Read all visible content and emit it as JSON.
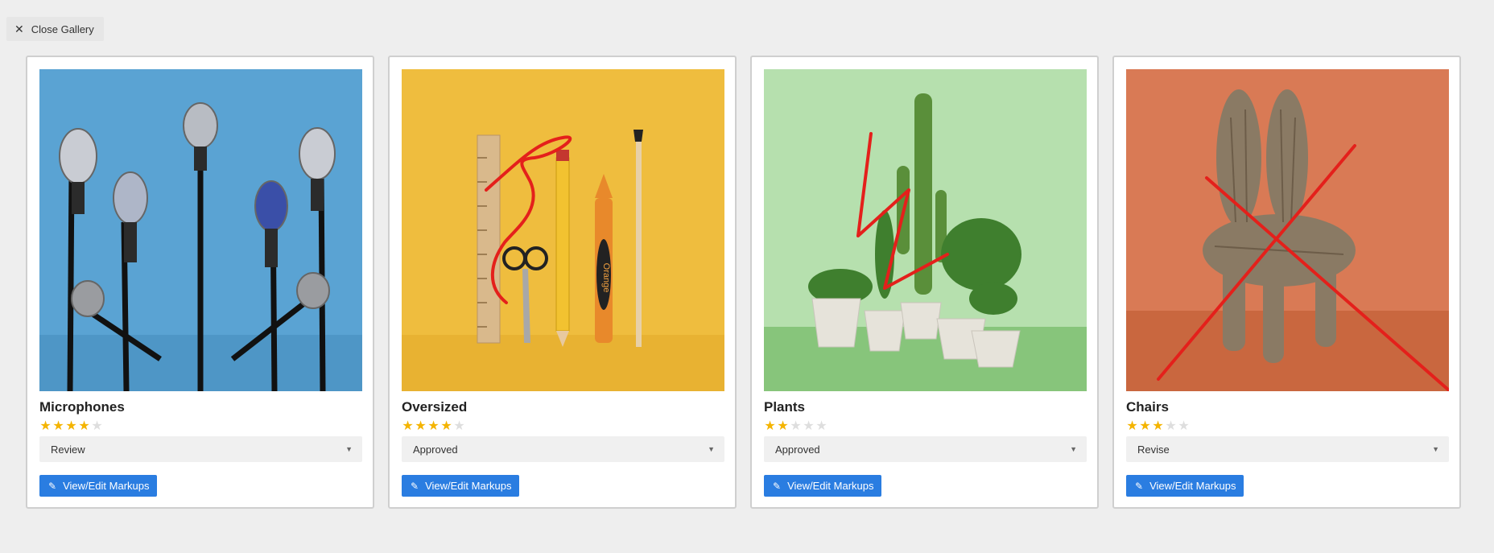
{
  "close_button": {
    "label": "Close Gallery",
    "icon": "close-icon"
  },
  "colors": {
    "accent": "#2a7de1",
    "star": "#f4b400",
    "markup": "#e4201b"
  },
  "cards": [
    {
      "title": "Microphones",
      "rating": 4,
      "max_rating": 5,
      "status": "Review",
      "button_label": "View/Edit Markups",
      "image": "microphones-photo",
      "markup": "none"
    },
    {
      "title": "Oversized",
      "rating": 4,
      "max_rating": 5,
      "status": "Approved",
      "button_label": "View/Edit Markups",
      "image": "oversized-stationery-photo",
      "markup": "red-scribble"
    },
    {
      "title": "Plants",
      "rating": 2,
      "max_rating": 5,
      "status": "Approved",
      "button_label": "View/Edit Markups",
      "image": "plants-photo",
      "markup": "red-zigzag"
    },
    {
      "title": "Chairs",
      "rating": 3,
      "max_rating": 5,
      "status": "Revise",
      "button_label": "View/Edit Markups",
      "image": "furry-chair-photo",
      "markup": "red-x"
    }
  ],
  "image_text": {
    "crayon_label": "Orange"
  }
}
